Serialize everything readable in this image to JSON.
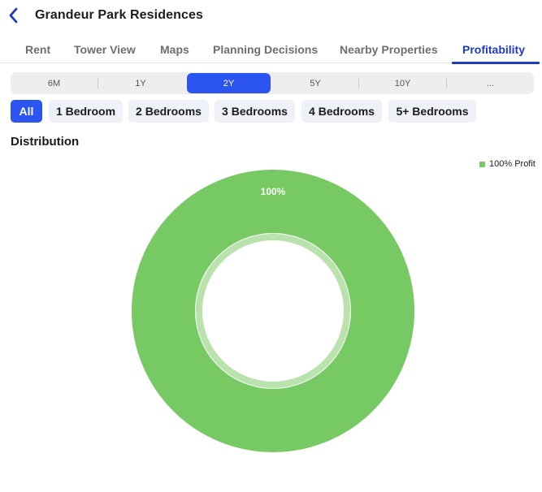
{
  "header": {
    "title": "Grandeur Park Residences"
  },
  "tabs": [
    {
      "label": "Rent",
      "active": false
    },
    {
      "label": "Tower View",
      "active": false
    },
    {
      "label": "Maps",
      "active": false
    },
    {
      "label": "Planning Decisions",
      "active": false
    },
    {
      "label": "Nearby Properties",
      "active": false
    },
    {
      "label": "Profitability",
      "active": true
    }
  ],
  "periods": {
    "options": [
      "6M",
      "1Y",
      "2Y",
      "5Y",
      "10Y",
      "..."
    ],
    "selected": "2Y"
  },
  "bedroom_filters": {
    "options": [
      "All",
      "1 Bedroom",
      "2 Bedrooms",
      "3 Bedrooms",
      "4 Bedrooms",
      "5+ Bedrooms"
    ],
    "selected": "All"
  },
  "section": {
    "title": "Distribution"
  },
  "colors": {
    "accent": "#2c54f0",
    "tab_active": "#1f3bbf",
    "profit": "#77c963"
  },
  "icons": {
    "back": "chevron-left-icon"
  },
  "chart_data": {
    "type": "pie",
    "style": "donut",
    "title": "",
    "categories": [
      "100% Profit"
    ],
    "values": [
      100
    ],
    "data_labels": [
      "100%"
    ],
    "colors": [
      "#77c963"
    ],
    "legend_position": "top-right"
  }
}
